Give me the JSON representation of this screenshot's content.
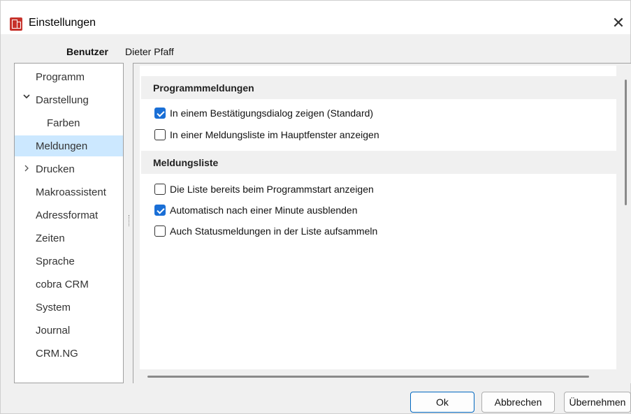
{
  "window": {
    "title": "Einstellungen",
    "close_label": "✕"
  },
  "user": {
    "label": "Benutzer",
    "value": "Dieter Pfaff"
  },
  "nav": {
    "items": [
      {
        "label": "Programm",
        "selected": false,
        "indent": 0,
        "arrow": ""
      },
      {
        "label": "Darstellung",
        "selected": false,
        "indent": 0,
        "arrow": "⌄"
      },
      {
        "label": "Farben",
        "selected": false,
        "indent": 1,
        "arrow": ""
      },
      {
        "label": "Meldungen",
        "selected": true,
        "indent": 0,
        "arrow": ""
      },
      {
        "label": "Drucken",
        "selected": false,
        "indent": 0,
        "arrow": "›"
      },
      {
        "label": "Makroassistent",
        "selected": false,
        "indent": 0,
        "arrow": ""
      },
      {
        "label": "Adressformat",
        "selected": false,
        "indent": 0,
        "arrow": ""
      },
      {
        "label": "Zeiten",
        "selected": false,
        "indent": 0,
        "arrow": ""
      },
      {
        "label": "Sprache",
        "selected": false,
        "indent": 0,
        "arrow": ""
      },
      {
        "label": "cobra CRM",
        "selected": false,
        "indent": 0,
        "arrow": ""
      },
      {
        "label": "System",
        "selected": false,
        "indent": 0,
        "arrow": ""
      },
      {
        "label": "Journal",
        "selected": false,
        "indent": 0,
        "arrow": ""
      },
      {
        "label": "CRM.NG",
        "selected": false,
        "indent": 0,
        "arrow": ""
      }
    ]
  },
  "sections": [
    {
      "title": "Programmmeldungen",
      "options": [
        {
          "label": "In einem Bestätigungsdialog zeigen (Standard)",
          "checked": true
        },
        {
          "label": "In einer Meldungsliste im Hauptfenster anzeigen",
          "checked": false
        }
      ]
    },
    {
      "title": "Meldungsliste",
      "options": [
        {
          "label": "Die Liste bereits beim Programmstart anzeigen",
          "checked": false
        },
        {
          "label": "Automatisch nach einer Minute ausblenden",
          "checked": true
        },
        {
          "label": "Auch Statusmeldungen in der Liste aufsammeln",
          "checked": false
        }
      ]
    }
  ],
  "buttons": {
    "ok": "Ok",
    "cancel": "Abbrechen",
    "apply": "Übernehmen"
  },
  "colors": {
    "accent": "#1a6fd6",
    "selection": "#cce8ff",
    "app_icon": "#c7332c"
  }
}
